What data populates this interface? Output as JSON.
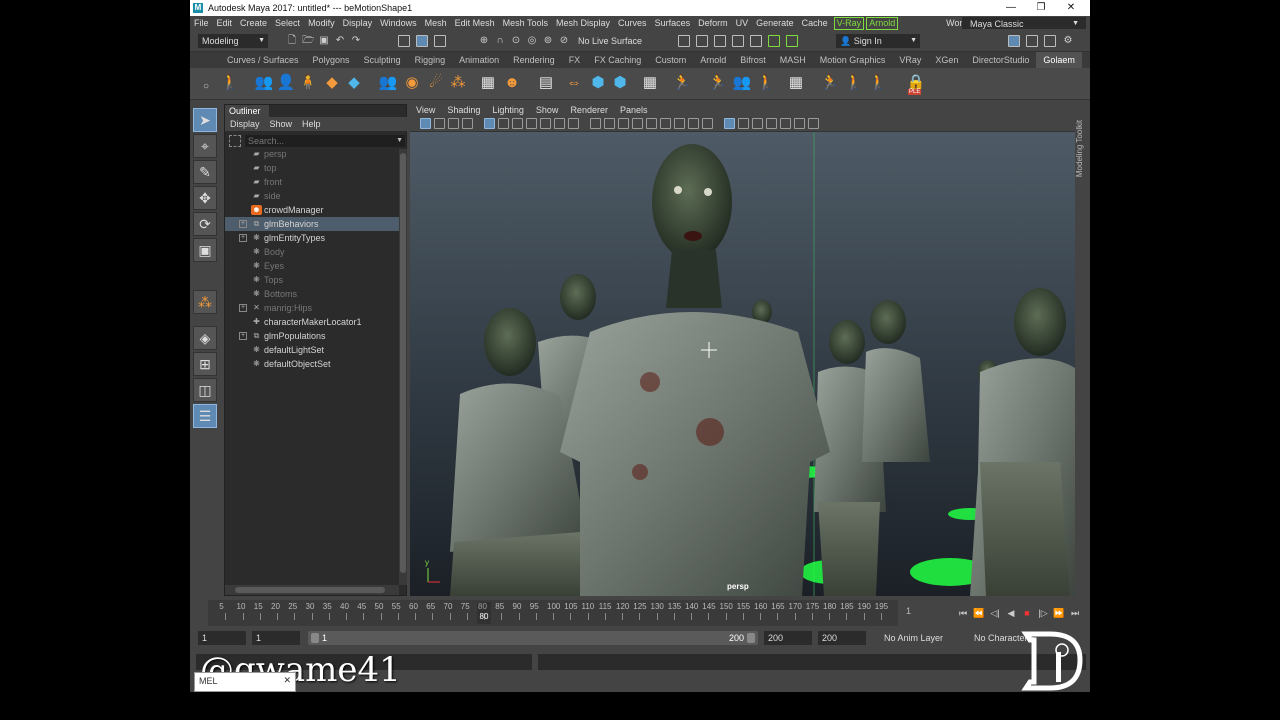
{
  "window": {
    "title": "Autodesk Maya 2017: untitled*   ---   beMotionShape1",
    "logo_letter": "M",
    "minimize": "—",
    "restore": "❐",
    "close": "✕"
  },
  "menubar": {
    "items": [
      "File",
      "Edit",
      "Create",
      "Select",
      "Modify",
      "Display",
      "Windows",
      "Mesh",
      "Edit Mesh",
      "Mesh Tools",
      "Mesh Display",
      "Curves",
      "Surfaces",
      "Deform",
      "UV",
      "Generate",
      "Cache"
    ],
    "vray_tag": "V-Ray",
    "arnold_tag": "Arnold",
    "workspace_label": "Workspace :",
    "workspace_value": "Maya Classic"
  },
  "statusline": {
    "menuset": "Modeling",
    "live_surface": "No Live Surface",
    "sign_in": "Sign In"
  },
  "shelf": {
    "tabs": [
      "Curves / Surfaces",
      "Polygons",
      "Sculpting",
      "Rigging",
      "Animation",
      "Rendering",
      "FX",
      "FX Caching",
      "Custom",
      "Arnold",
      "Bifrost",
      "MASH",
      "Motion Graphics",
      "VRay",
      "XGen",
      "DirectorStudio",
      "Golaem"
    ],
    "active_tab": "Golaem",
    "ple_label": "PLE"
  },
  "outliner": {
    "tab": "Outliner",
    "menu": [
      "Display",
      "Show",
      "Help"
    ],
    "search_placeholder": "Search...",
    "items": [
      {
        "label": "persp",
        "icon": "camera-icon",
        "dim": true,
        "expand": ""
      },
      {
        "label": "top",
        "icon": "camera-icon",
        "dim": true,
        "expand": ""
      },
      {
        "label": "front",
        "icon": "camera-icon",
        "dim": true,
        "expand": ""
      },
      {
        "label": "side",
        "icon": "camera-icon",
        "dim": true,
        "expand": ""
      },
      {
        "label": "crowdManager",
        "icon": "crowd-manager-icon",
        "dim": false,
        "expand": ""
      },
      {
        "label": "glmBehaviors",
        "icon": "behavior-icon",
        "dim": false,
        "expand": "+",
        "selected": true
      },
      {
        "label": "glmEntityTypes",
        "icon": "set-icon",
        "dim": false,
        "expand": "+"
      },
      {
        "label": "Body",
        "icon": "set-icon",
        "dim": true,
        "expand": ""
      },
      {
        "label": "Eyes",
        "icon": "set-icon",
        "dim": true,
        "expand": ""
      },
      {
        "label": "Tops",
        "icon": "set-icon",
        "dim": true,
        "expand": ""
      },
      {
        "label": "Bottoms",
        "icon": "set-icon",
        "dim": true,
        "expand": ""
      },
      {
        "label": "manrig:Hips",
        "icon": "joint-icon",
        "dim": true,
        "expand": "+"
      },
      {
        "label": "characterMakerLocator1",
        "icon": "locator-icon",
        "dim": false,
        "expand": ""
      },
      {
        "label": "glmPopulations",
        "icon": "behavior-icon",
        "dim": false,
        "expand": "+"
      },
      {
        "label": "defaultLightSet",
        "icon": "set-icon",
        "dim": false,
        "expand": ""
      },
      {
        "label": "defaultObjectSet",
        "icon": "set-icon",
        "dim": false,
        "expand": ""
      }
    ]
  },
  "viewport": {
    "menu": [
      "View",
      "Shading",
      "Lighting",
      "Show",
      "Renderer",
      "Panels"
    ],
    "camera": "persp",
    "axis_label": "y"
  },
  "modeling_toolkit": "Modeling Toolkit",
  "timeslider": {
    "ticks": [
      5,
      10,
      15,
      20,
      25,
      30,
      35,
      40,
      45,
      50,
      55,
      60,
      65,
      70,
      75,
      80,
      85,
      90,
      95,
      100,
      105,
      110,
      115,
      120,
      125,
      130,
      135,
      140,
      145,
      150,
      155,
      160,
      165,
      170,
      175,
      180,
      185,
      190,
      195
    ],
    "current_frame": "80",
    "end_tick": "1"
  },
  "range": {
    "start_field": "1",
    "start_field2": "1",
    "slider_start": "1",
    "slider_end": "200",
    "end_field": "200",
    "end_field2": "200",
    "anim_layer": "No Anim Layer",
    "character_set": "No Character S"
  },
  "command": {
    "mel_label": "MEL"
  },
  "overlay": {
    "handle": "@qwame41"
  },
  "colors": {
    "accent": "#5e8ab3",
    "vray_green": "#7fdc3f",
    "maya_teal": "#27b6c4",
    "golaem_orange": "#e86b1f",
    "stop_red": "#e33333"
  }
}
